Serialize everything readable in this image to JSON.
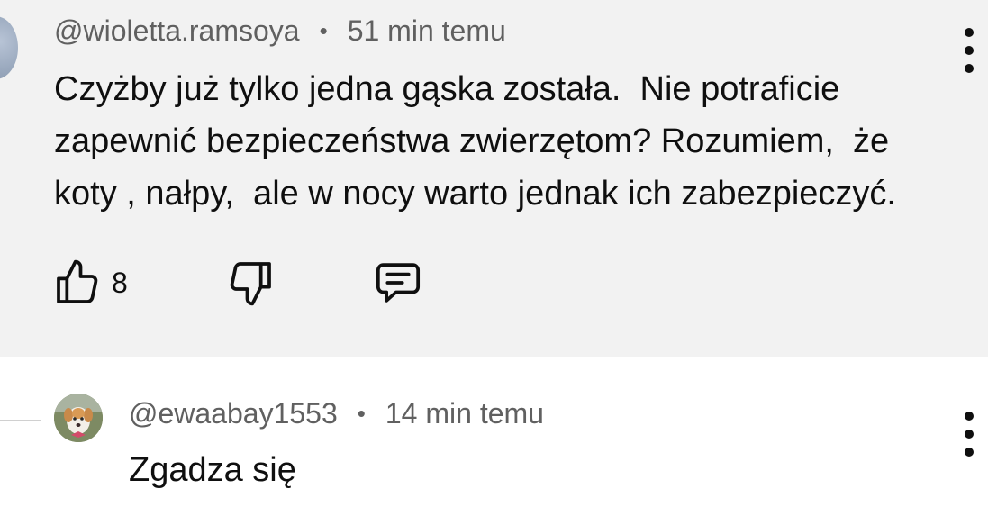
{
  "comment": {
    "username": "@wioletta.ramsoya",
    "separator": "•",
    "time": "51 min temu",
    "text": "Czyżby już tylko jedna gąska została.  Nie potraficie\nzapewnić bezpieczeństwa zwierzętom? Rozumiem,  że\nkoty , nałpy,  ale w nocy warto jednak ich zabezpieczyć.",
    "like_count": "8",
    "icons": {
      "like": "thumbs-up-icon",
      "dislike": "thumbs-down-icon",
      "reply": "comment-bubble-icon",
      "menu": "more-vertical-icon"
    }
  },
  "reply": {
    "username": "@ewaabay1553",
    "separator": "•",
    "time": "14 min temu",
    "text": "Zgadza się",
    "icons": {
      "avatar": "dog-avatar",
      "menu": "more-vertical-icon"
    }
  },
  "colors": {
    "highlight_background": "#f2f2f2",
    "meta_text": "#606060",
    "body_text": "#0f0f0f"
  }
}
